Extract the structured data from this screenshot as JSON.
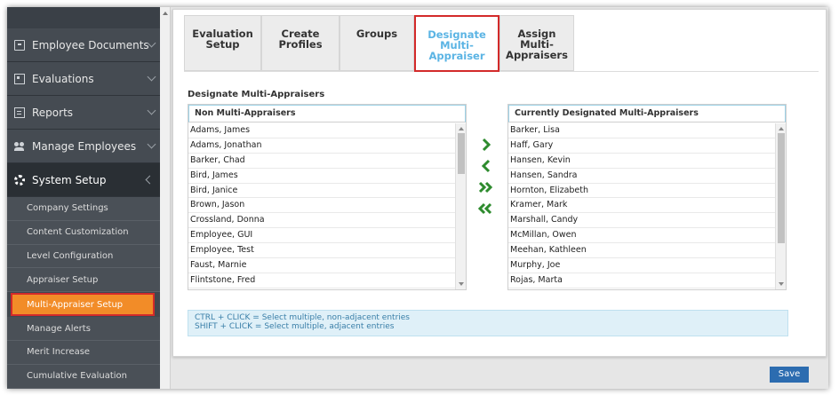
{
  "sidebar": {
    "main_items": [
      {
        "label": "Employee Documents",
        "icon": "document-icon"
      },
      {
        "label": "Evaluations",
        "icon": "id-card-icon"
      },
      {
        "label": "Reports",
        "icon": "report-icon"
      },
      {
        "label": "Manage Employees",
        "icon": "users-icon"
      },
      {
        "label": "System Setup",
        "icon": "gear-icon"
      }
    ],
    "sub_items": [
      "Company Settings",
      "Content Customization",
      "Level Configuration",
      "Appraiser Setup",
      "Multi-Appraiser Setup",
      "Manage Alerts",
      "Merit Increase",
      "Cumulative Evaluation"
    ],
    "selected_sub": "Multi-Appraiser Setup"
  },
  "tabs": [
    {
      "line1": "Evaluation",
      "line2": "Setup"
    },
    {
      "line1": "Create Profiles",
      "line2": ""
    },
    {
      "line1": "Groups",
      "line2": ""
    },
    {
      "line1": "Designate Multi-",
      "line2": "Appraiser"
    },
    {
      "line1": "Assign Multi-",
      "line2": "Appraisers"
    }
  ],
  "active_tab": "Designate Multi-Appraiser",
  "section_title": "Designate Multi-Appraisers",
  "left_list": {
    "header": "Non Multi-Appraisers",
    "items": [
      "Adams, James",
      "Adams, Jonathan",
      "Barker, Chad",
      "Bird, James",
      "Bird, Janice",
      "Brown, Jason",
      "Crossland, Donna",
      "Employee, GUI",
      "Employee, Test",
      "Faust, Marnie",
      "Flintstone, Fred"
    ]
  },
  "right_list": {
    "header": "Currently Designated Multi-Appraisers",
    "items": [
      "Barker, Lisa",
      "Haff, Gary",
      "Hansen, Kevin",
      "Hansen, Sandra",
      "Hornton, Elizabeth",
      "Kramer, Mark",
      "Marshall, Candy",
      "McMillan, Owen",
      "Meehan, Kathleen",
      "Murphy, Joe",
      "Rojas, Marta"
    ]
  },
  "hint": {
    "line1": "CTRL + CLICK = Select multiple, non-adjacent entries",
    "line2": "SHIFT + CLICK = Select multiple, adjacent entries"
  },
  "save_label": "Save",
  "colors": {
    "accent": "#f28c28",
    "arrow": "#2e8b2e",
    "tab_active": "#5bb4e4",
    "highlight": "#d32a2a",
    "save": "#2c6cb0"
  }
}
